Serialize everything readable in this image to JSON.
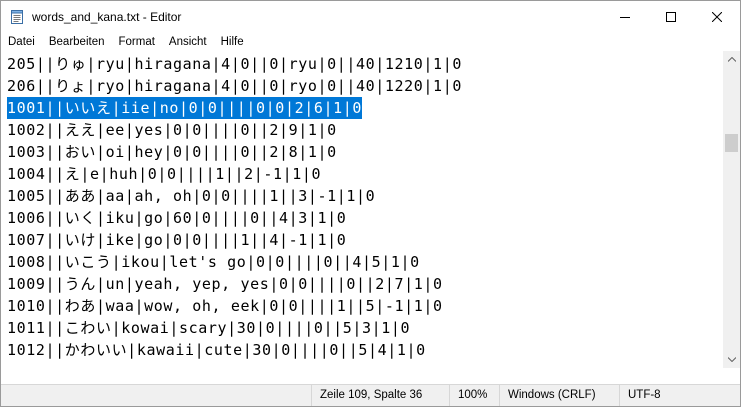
{
  "window": {
    "title": "words_and_kana.txt - Editor"
  },
  "menu": [
    "Datei",
    "Bearbeiten",
    "Format",
    "Ansicht",
    "Hilfe"
  ],
  "editor": {
    "lines": [
      "205||りゅ|ryu|hiragana|4|0||0|ryu|0||40|1210|1|0",
      "206||りょ|ryo|hiragana|4|0||0|ryo|0||40|1220|1|0",
      "1001||いいえ|iie|no|0|0||||0|0|2|6|1|0",
      "1002||ええ|ee|yes|0|0||||0||2|9|1|0",
      "1003||おい|oi|hey|0|0||||0||2|8|1|0",
      "1004||え|e|huh|0|0||||1||2|-1|1|0",
      "1005||ああ|aa|ah, oh|0|0||||1||3|-1|1|0",
      "1006||いく|iku|go|60|0||||0||4|3|1|0",
      "1007||いけ|ike|go|0|0||||1||4|-1|1|0",
      "1008||いこう|ikou|let's go|0|0||||0||4|5|1|0",
      "1009||うん|un|yeah, yep, yes|0|0||||0||2|7|1|0",
      "1010||わあ|waa|wow, oh, eek|0|0||||1||5|-1|1|0",
      "1011||こわい|kowai|scary|30|0||||0||5|3|1|0",
      "1012||かわいい|kawaii|cute|30|0||||0||5|4|1|0"
    ],
    "selected_line_index": 2
  },
  "status": {
    "position": "Zeile 109, Spalte 36",
    "zoom": "100%",
    "line_ending": "Windows (CRLF)",
    "encoding": "UTF-8"
  },
  "scrollbar": {
    "position_fraction": 0.03
  },
  "icons": {
    "app": "notepad-icon",
    "minimize": "minimize-icon",
    "maximize": "maximize-icon",
    "close": "close-icon"
  },
  "colors": {
    "selection": "#0078d7",
    "statusbar": "#f0f0f0"
  }
}
